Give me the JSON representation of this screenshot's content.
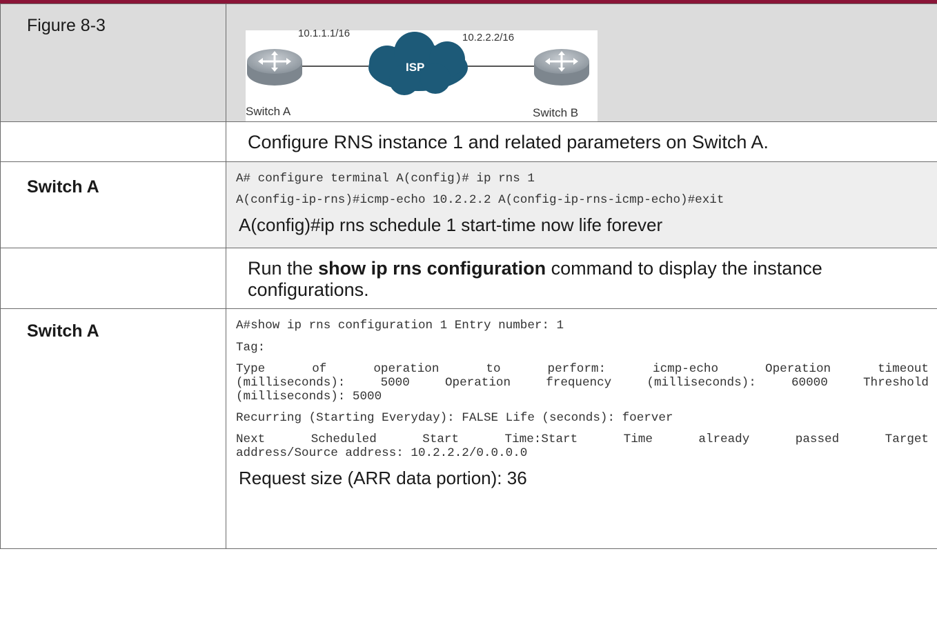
{
  "figure": {
    "label": "Figure 8-3",
    "switch_a": "Switch A",
    "switch_b": "Switch B",
    "ip_a": "10.1.1.1/16",
    "ip_b": "10.2.2.2/16",
    "cloud": "ISP"
  },
  "step1": {
    "text": "Configure RNS instance 1 and related parameters on Switch A.",
    "device": "Switch A",
    "line1": "A# configure terminal A(config)# ip rns 1",
    "line2": "A(config-ip-rns)#icmp-echo 10.2.2.2 A(config-ip-rns-icmp-echo)#exit",
    "line3": "A(config)#ip rns schedule 1 start-time now life forever"
  },
  "step2": {
    "text_pre": "Run the ",
    "command": "show ip rns configuration",
    "text_post": " command to display the instance configurations.",
    "device": "Switch A",
    "line1": "A#show ip rns configuration 1 Entry number: 1",
    "line2": "Tag:",
    "line3a": "Type of operation to perform: icmp-echo Operation timeout",
    "line3b": "(milliseconds): 5000 Operation frequency (milliseconds): 60000 Threshold",
    "line3c": "(milliseconds): 5000",
    "line4": "Recurring (Starting Everyday): FALSE Life (seconds): foerver",
    "line5a": "Next Scheduled Start Time:Start Time already passed Target",
    "line5b": "address/Source address: 10.2.2.2/0.0.0.0",
    "line6": "Request size (ARR data portion): 36"
  },
  "colors": {
    "accent": "#8a1538",
    "label_gray": "#dcdcdc",
    "code_gray": "#eeeeee",
    "cloud": "#1d5a78"
  }
}
